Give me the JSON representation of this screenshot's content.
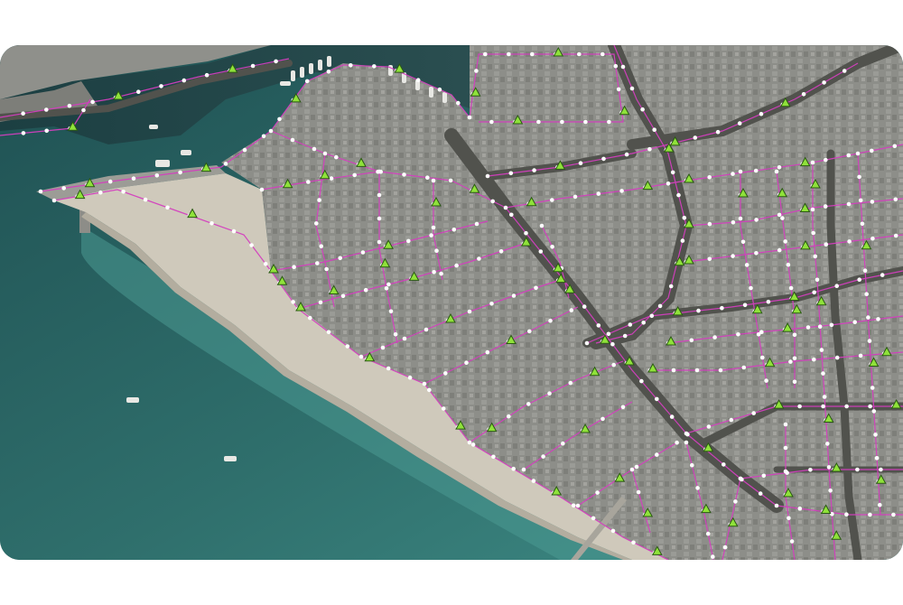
{
  "map": {
    "kind": "satellite-imagery-with-network-overlay",
    "colors": {
      "sea_deep": "#1d4a4d",
      "sea_shallow": "#3e8b86",
      "beach": "#cfc9bb",
      "urban": "#8e8f8a",
      "road": "#555651",
      "edge_line": "#d43fbf",
      "vertex": "#ffffff",
      "marker_fill": "#8fe23a",
      "marker_stroke": "#2a5a12"
    },
    "legend": [],
    "labels": []
  }
}
